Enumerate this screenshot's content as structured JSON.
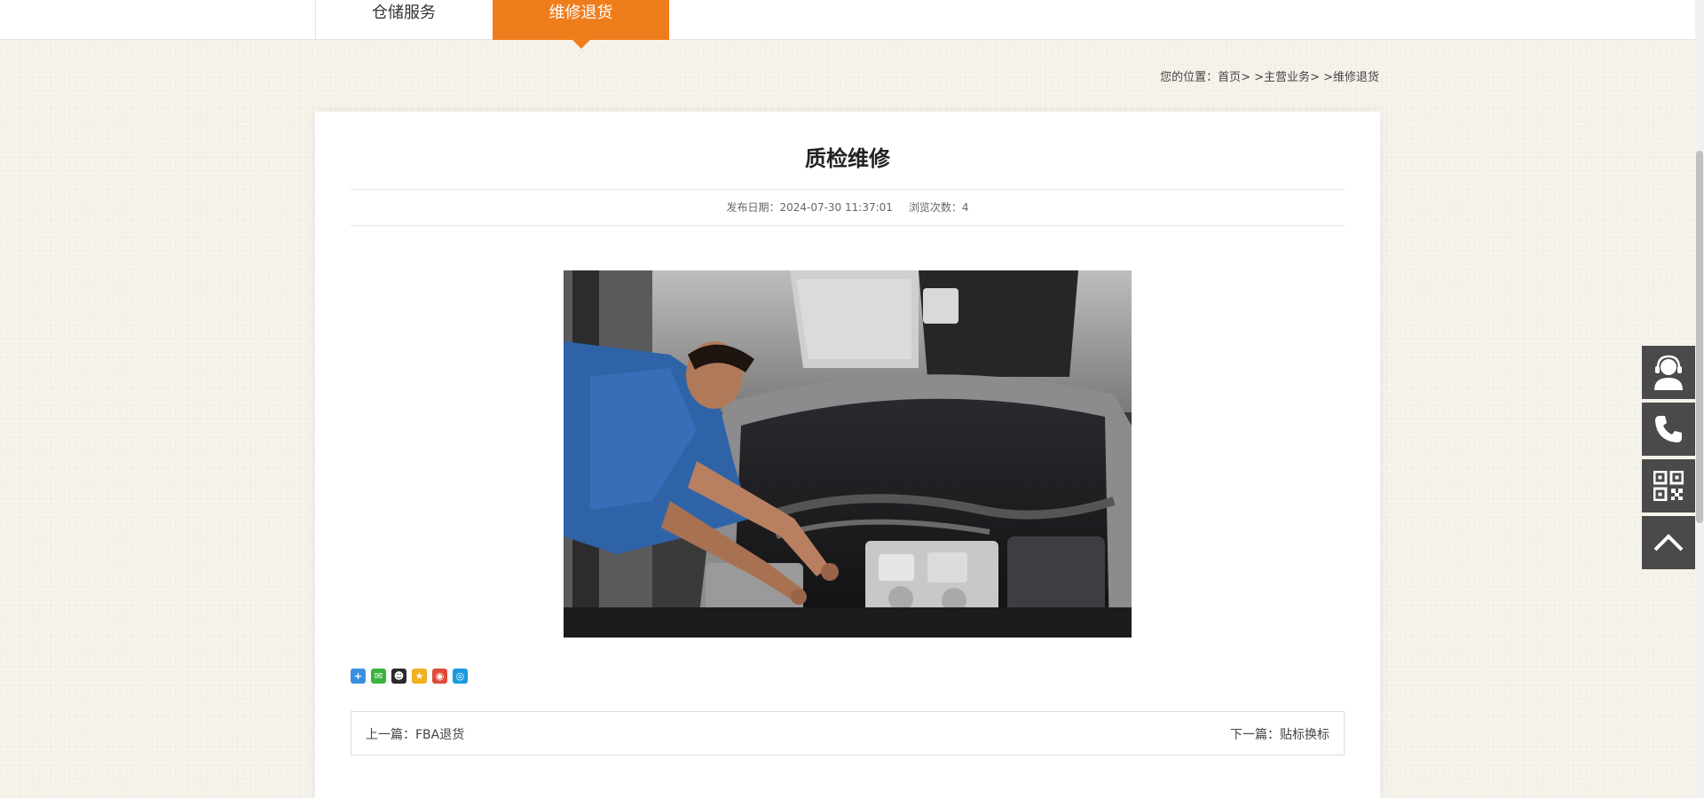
{
  "tabs": [
    {
      "label": "仓储服务",
      "active": false
    },
    {
      "label": "维修退货",
      "active": true
    }
  ],
  "breadcrumb": {
    "prefix": "您的位置：",
    "home": "首页",
    "sep": "> >",
    "section": "主营业务",
    "current": "维修退货"
  },
  "article": {
    "title": "质检维修",
    "date_label": "发布日期：",
    "date_value": "2024-07-30 11:37:01",
    "views_label": "浏览次数：",
    "views_value": "4",
    "image_alt": "mechanic-working-on-car-engine"
  },
  "share_icons": [
    {
      "name": "share-more-icon",
      "glyph": "+",
      "color": "#3b8fe0"
    },
    {
      "name": "wechat-icon",
      "glyph": "✉",
      "color": "#3bb43b"
    },
    {
      "name": "qq-icon",
      "glyph": "☻",
      "color": "#2a2a2a"
    },
    {
      "name": "qzone-icon",
      "glyph": "★",
      "color": "#f0b020"
    },
    {
      "name": "weibo-icon",
      "glyph": "◉",
      "color": "#e04a3a"
    },
    {
      "name": "tencent-weibo-icon",
      "glyph": "◎",
      "color": "#1a9ae0"
    }
  ],
  "pager": {
    "prev_label": "上一篇：",
    "prev_title": "FBA退货",
    "next_label": "下一篇：",
    "next_title": "贴标换标"
  },
  "float_widget": [
    "customer-service-icon",
    "phone-icon",
    "qr-code-icon",
    "back-to-top-icon"
  ],
  "colors": {
    "accent": "#f07d1c",
    "float_bg": "#4a4a4a",
    "page_bg": "#f5f2ea"
  }
}
